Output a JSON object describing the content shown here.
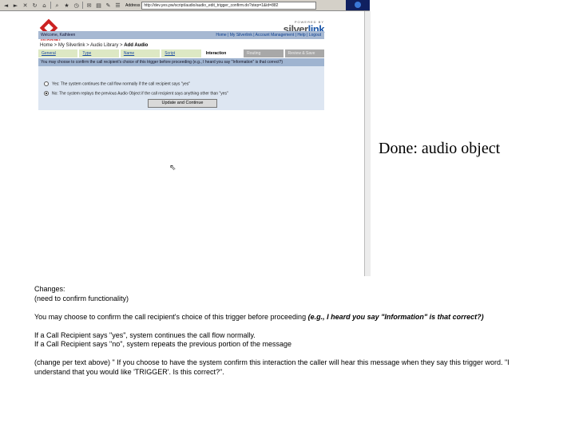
{
  "browser": {
    "address_label": "Address",
    "address_url": "http://dev.yes.pw/script/audio/audio_edit_trigger_confirm.do?step=1&id=882",
    "toolbar_icons": [
      "back-icon",
      "forward-icon",
      "stop-icon",
      "refresh-icon",
      "home-icon",
      "search-icon",
      "favorites-icon",
      "history-icon",
      "mail-icon",
      "print-icon",
      "edit-icon",
      "discuss-icon"
    ]
  },
  "app": {
    "logo_text": "INTRANET",
    "brand": {
      "powered": "POWERED BY",
      "name_part1": "silver",
      "name_part2": "link",
      "sub": "COMMUNICATIONS"
    },
    "welcome": "Welcome, Kathleen",
    "top_links": "Home | My Silverlink | Account Management | Help | Logout",
    "breadcrumb": {
      "trail": "Home > My Silverlink > Audio Library > ",
      "current": "Add Audio"
    },
    "steps": [
      {
        "label": "General",
        "state": "link"
      },
      {
        "label": "Type",
        "state": "link"
      },
      {
        "label": "Name",
        "state": "link"
      },
      {
        "label": "Script",
        "state": "link"
      },
      {
        "label": "Interaction",
        "state": "active"
      },
      {
        "label": "Routing",
        "state": "future"
      },
      {
        "label": "Review & Save",
        "state": "future"
      }
    ],
    "panel_heading": "You may choose to confirm the call recipient's choice of this trigger before proceeding (e.g., I heard you say \"Information\" is that correct?)",
    "option_yes": "Yes: The system continues the call flow normally if the call recipient says \"yes\"",
    "option_no": "No: The system replays the previous Audio Object if the call recipient says anything other than \"yes\"",
    "selected_option": "no",
    "button_label": "Update and Continue"
  },
  "slide": {
    "caption": "Done: audio object",
    "notes": {
      "line1": "Changes:",
      "line2": "(need to confirm functionality)",
      "line3_plain": "You may choose to confirm the call recipient's choice of this trigger before proceeding ",
      "line3_em": "(e.g., I heard you say \"Information\" is that correct?)",
      "line4": "If a Call Recipient says \"yes\", system continues the call flow normally.",
      "line5": "If a Call Recipient says \"no\", system repeats the previous portion of the message",
      "line6": "(change per text above) \" If you choose to have the system confirm this interaction the caller will hear this message when they say this trigger word. \"I understand that you would like 'TRIGGER'. Is this correct?\"."
    }
  }
}
